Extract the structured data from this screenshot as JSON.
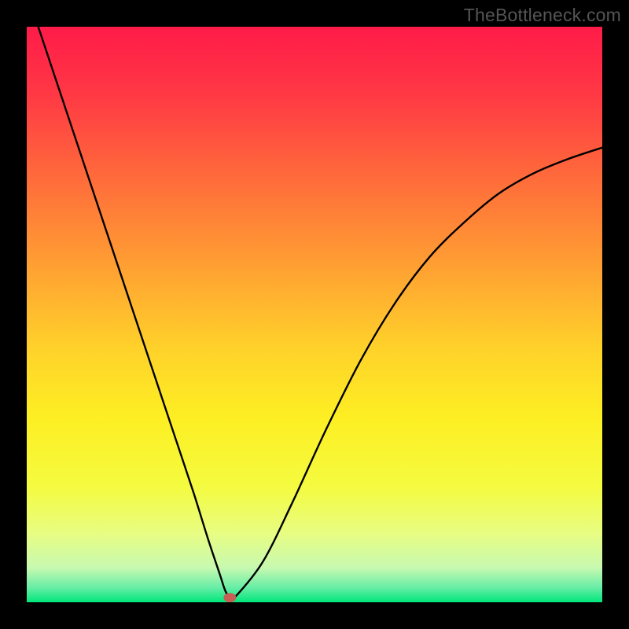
{
  "watermark": "TheBottleneck.com",
  "chart_data": {
    "type": "line",
    "title": "",
    "xlabel": "",
    "ylabel": "",
    "xlim": [
      0,
      100
    ],
    "ylim": [
      0,
      100
    ],
    "curve": {
      "name": "bottleneck-curve",
      "x": [
        2,
        5,
        8,
        11,
        14,
        17,
        20,
        23,
        26,
        29,
        31.5,
        33.5,
        34.5,
        35.3,
        36.1,
        41,
        46,
        52,
        58,
        64,
        70,
        76,
        82,
        88,
        94,
        100
      ],
      "y": [
        100,
        91,
        82,
        73,
        64,
        55,
        46,
        37,
        28,
        19,
        11,
        5,
        2,
        0.8,
        0.8,
        7,
        17,
        30,
        42,
        52,
        60,
        66,
        71,
        74.5,
        77,
        79
      ]
    },
    "marker": {
      "name": "current-point",
      "x": 35.3,
      "y": 0.8,
      "color": "#c76054"
    },
    "background": {
      "type": "vertical-gradient",
      "stops": [
        {
          "pos": 0.0,
          "color": "#ff1b49"
        },
        {
          "pos": 0.12,
          "color": "#ff3944"
        },
        {
          "pos": 0.26,
          "color": "#ff6a3b"
        },
        {
          "pos": 0.42,
          "color": "#ffa132"
        },
        {
          "pos": 0.56,
          "color": "#ffd22a"
        },
        {
          "pos": 0.68,
          "color": "#fdef23"
        },
        {
          "pos": 0.8,
          "color": "#f4fb40"
        },
        {
          "pos": 0.88,
          "color": "#e8fd82"
        },
        {
          "pos": 0.94,
          "color": "#c7f9b0"
        },
        {
          "pos": 0.975,
          "color": "#66eda6"
        },
        {
          "pos": 1.0,
          "color": "#00e77a"
        }
      ]
    }
  }
}
